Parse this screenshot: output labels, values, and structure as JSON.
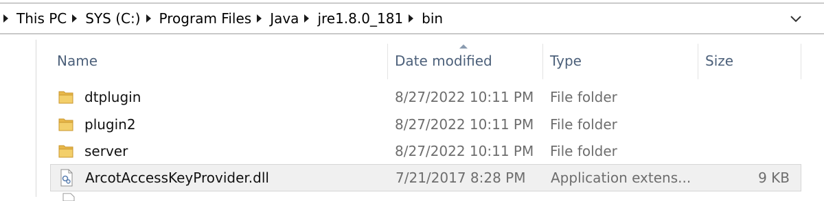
{
  "address_bar": {
    "crumbs": [
      "This PC",
      "SYS (C:)",
      "Program Files",
      "Java",
      "jre1.8.0_181",
      "bin"
    ]
  },
  "columns": {
    "name": "Name",
    "date": "Date modified",
    "type": "Type",
    "size": "Size"
  },
  "sort": {
    "column": "date",
    "direction": "ascending-indicator"
  },
  "files": [
    {
      "name": "dtplugin",
      "date": "8/27/2022 10:11 PM",
      "type": "File folder",
      "size": "",
      "icon": "folder-icon"
    },
    {
      "name": "plugin2",
      "date": "8/27/2022 10:11 PM",
      "type": "File folder",
      "size": "",
      "icon": "folder-icon"
    },
    {
      "name": "server",
      "date": "8/27/2022 10:11 PM",
      "type": "File folder",
      "size": "",
      "icon": "folder-icon"
    },
    {
      "name": "ArcotAccessKeyProvider.dll",
      "date": "7/21/2017 8:28 PM",
      "type": "Application extens...",
      "size": "9 KB",
      "icon": "dll-file-icon",
      "selected": true
    }
  ],
  "colors": {
    "header_text": "#4c607a",
    "folder_yellow": "#e8b84a",
    "selection_bg": "#f0f0f0"
  }
}
